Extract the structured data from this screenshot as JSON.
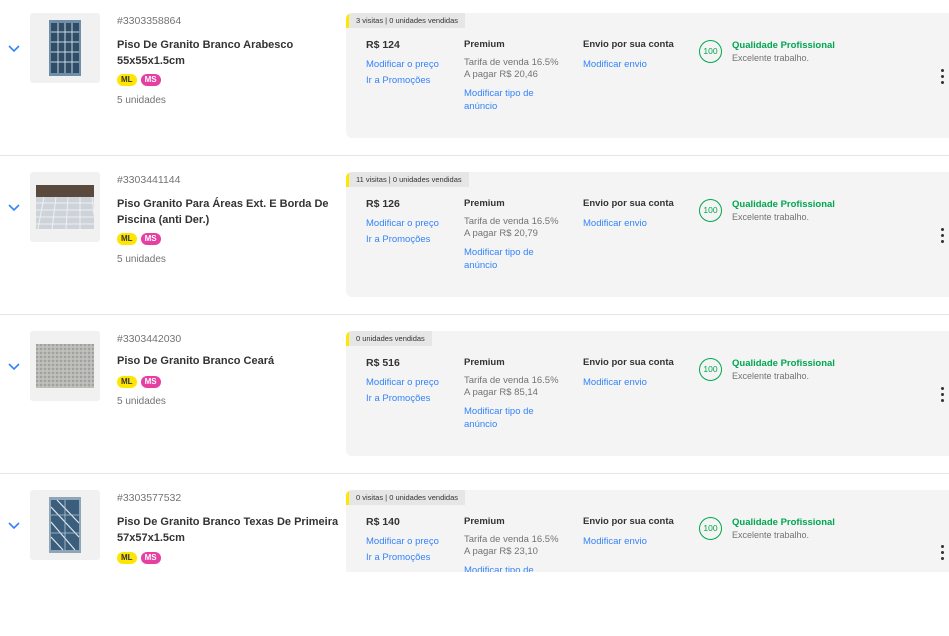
{
  "listings": [
    {
      "sku": "#3303358864",
      "title": "Piso De Granito Branco Arabesco 55x55x1.5cm",
      "badges": {
        "ml": "ML",
        "ms": "MS"
      },
      "units": "5 unidades",
      "visits": "3 visitas | 0 unidades vendidas",
      "price": "R$ 124",
      "edit_price": "Modificar o preço",
      "promotions": "Ir a Promoções",
      "type": "Premium",
      "fee": "Tarifa de venda 16.5%",
      "to_pay": "A pagar R$ 20,46",
      "edit_type": "Modificar tipo de anúncio",
      "shipping": "Envio por sua conta",
      "edit_shipping": "Modificar envio",
      "score": "100",
      "quality_title": "Qualidade Profissional",
      "quality_sub": "Excelente trabalho.",
      "thumb": "mosaic-tiles"
    },
    {
      "sku": "#3303441144",
      "title": "Piso Granito Para Áreas Ext. E Borda De Piscina (anti Der.)",
      "badges": {
        "ml": "ML",
        "ms": "MS"
      },
      "units": "5 unidades",
      "visits": "11 visitas | 0 unidades vendidas",
      "price": "R$ 126",
      "edit_price": "Modificar o preço",
      "promotions": "Ir a Promoções",
      "type": "Premium",
      "fee": "Tarifa de venda 16.5%",
      "to_pay": "A pagar R$ 20,79",
      "edit_type": "Modificar tipo de anúncio",
      "shipping": "Envio por sua conta",
      "edit_shipping": "Modificar envio",
      "score": "100",
      "quality_title": "Qualidade Profissional",
      "quality_sub": "Excelente trabalho.",
      "thumb": "paved-floor"
    },
    {
      "sku": "#3303442030",
      "title": "Piso De Granito Branco Ceará",
      "badges": {
        "ml": "ML",
        "ms": "MS"
      },
      "units": "5 unidades",
      "visits": "0 unidades vendidas",
      "price": "R$ 516",
      "edit_price": "Modificar o preço",
      "promotions": "Ir a Promoções",
      "type": "Premium",
      "fee": "Tarifa de venda 16.5%",
      "to_pay": "A pagar R$ 85,14",
      "edit_type": "Modificar tipo de anúncio",
      "shipping": "Envio por sua conta",
      "edit_shipping": "Modificar envio",
      "score": "100",
      "quality_title": "Qualidade Profissional",
      "quality_sub": "Excelente trabalho.",
      "thumb": "granite-slab"
    },
    {
      "sku": "#3303577532",
      "title": "Piso De Granito Branco Texas De Primeira 57x57x1.5cm",
      "badges": {
        "ml": "ML",
        "ms": "MS"
      },
      "units": "",
      "visits": "0 visitas | 0 unidades vendidas",
      "price": "R$ 140",
      "edit_price": "Modificar o preço",
      "promotions": "Ir a Promoções",
      "type": "Premium",
      "fee": "Tarifa de venda 16.5%",
      "to_pay": "A pagar R$ 23,10",
      "edit_type": "Modificar tipo de",
      "shipping": "Envio por sua conta",
      "edit_shipping": "Modificar envio",
      "score": "100",
      "quality_title": "Qualidade Profissional",
      "quality_sub": "Excelente trabalho.",
      "thumb": "wrapped-tiles"
    }
  ],
  "colors": {
    "link": "#3483fa",
    "quality": "#00a650",
    "ml_badge": "#ffe600",
    "ms_badge": "#e63ea1"
  }
}
